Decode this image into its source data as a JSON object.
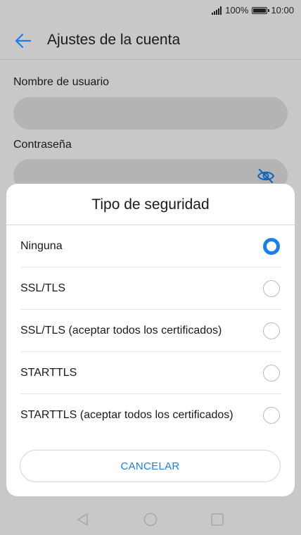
{
  "status_bar": {
    "battery_text": "100%",
    "time": "10:00",
    "signal_icon": "signal-icon",
    "battery_icon": "battery-icon"
  },
  "app_bar": {
    "title": "Ajustes de la cuenta",
    "back_icon": "arrow-left-icon",
    "accent_color": "#1a7ef2"
  },
  "form": {
    "username_label": "Nombre de usuario",
    "username_value": "",
    "password_label": "Contraseña",
    "password_value": "",
    "password_toggle_icon": "eye-off-icon"
  },
  "dialog": {
    "title": "Tipo de seguridad",
    "options": [
      {
        "label": "Ninguna",
        "selected": true
      },
      {
        "label": "SSL/TLS",
        "selected": false
      },
      {
        "label": "SSL/TLS (aceptar todos los certificados)",
        "selected": false
      },
      {
        "label": "STARTTLS",
        "selected": false
      },
      {
        "label": "STARTTLS (aceptar todos los certificados)",
        "selected": false
      }
    ],
    "cancel_label": "CANCELAR"
  },
  "nav_bar": {
    "back_icon": "triangle-back-icon",
    "home_icon": "circle-home-icon",
    "recents_icon": "square-recents-icon"
  }
}
